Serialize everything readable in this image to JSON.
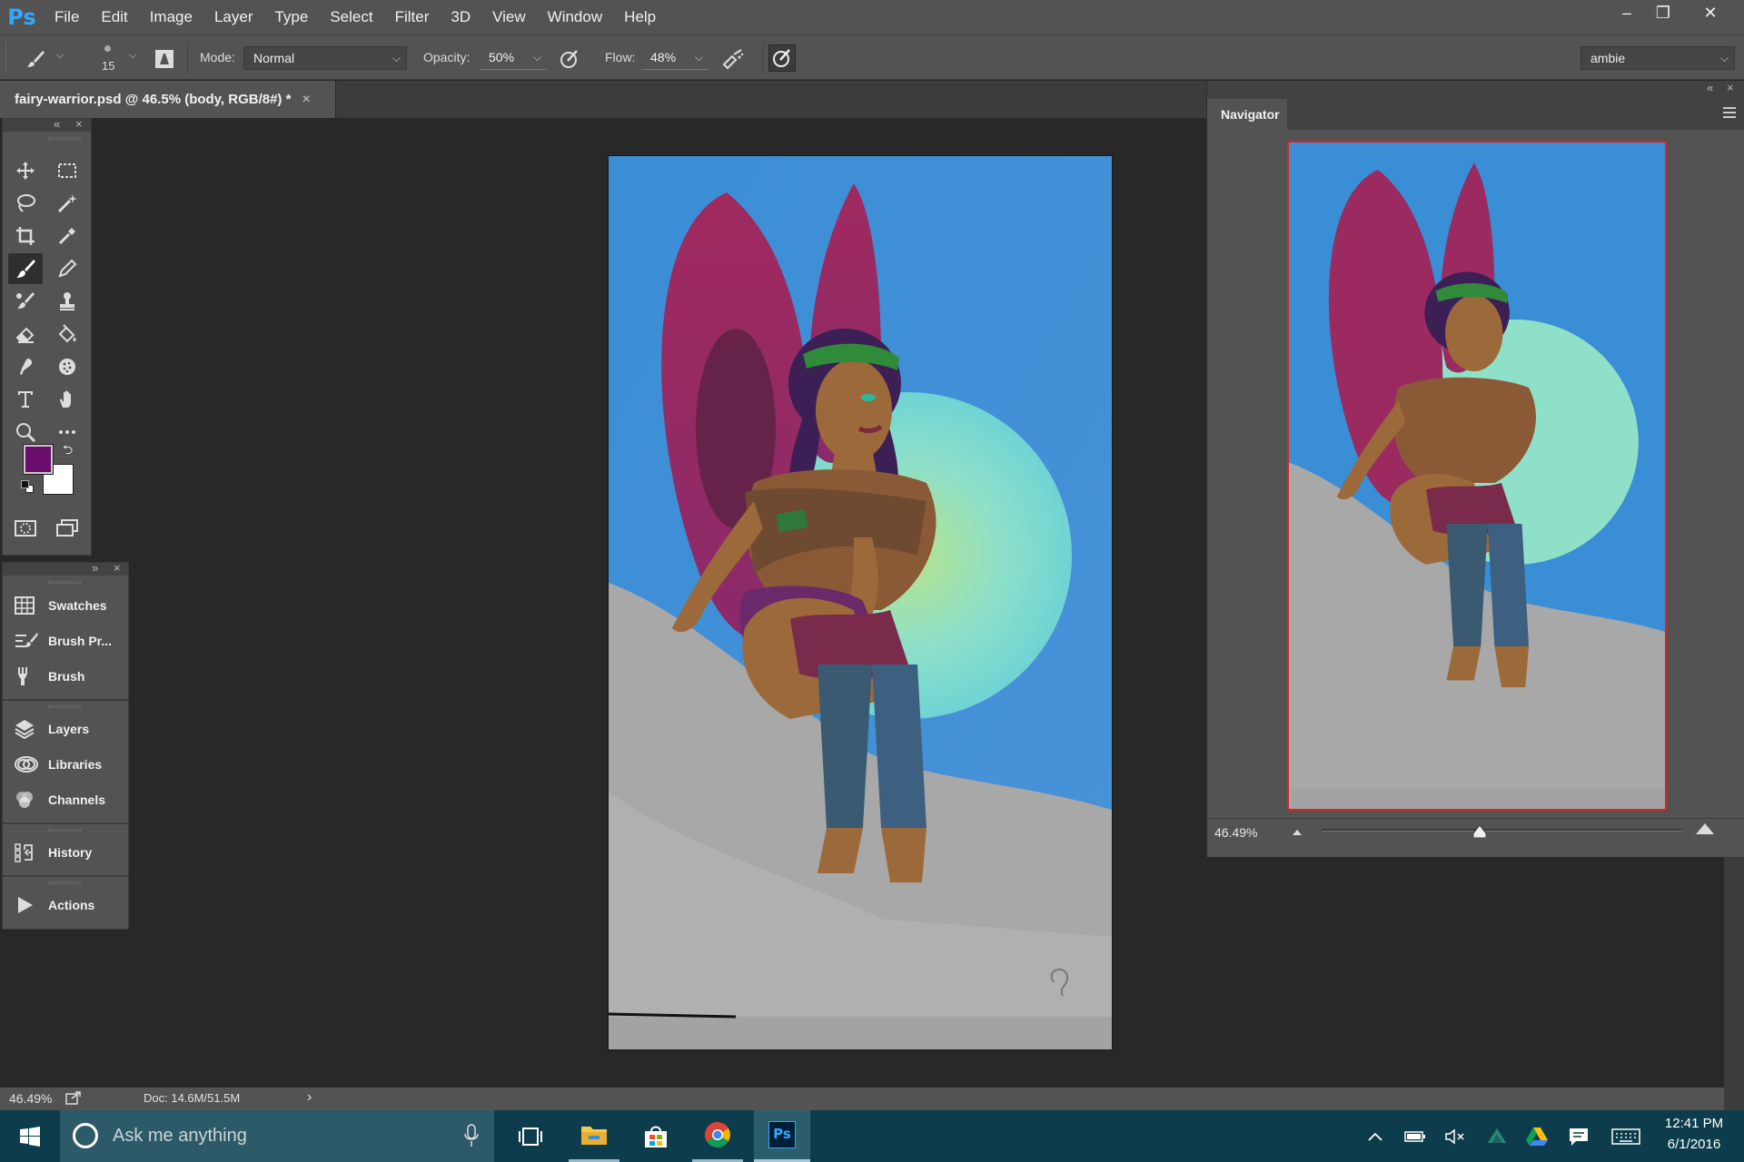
{
  "app": {
    "logo": "Ps",
    "menu": [
      "File",
      "Edit",
      "Image",
      "Layer",
      "Type",
      "Select",
      "Filter",
      "3D",
      "View",
      "Window",
      "Help"
    ],
    "window_controls": {
      "minimize": "‒",
      "restore": "❐",
      "close": "✕"
    }
  },
  "options": {
    "brush_size": "15",
    "mode_label": "Mode:",
    "mode_value": "Normal",
    "opacity_label": "Opacity:",
    "opacity_value": "50%",
    "flow_label": "Flow:",
    "flow_value": "48%",
    "workspace": "ambie"
  },
  "document": {
    "tab_title": "fairy-warrior.psd @ 46.5% (body, RGB/8#) *",
    "close": "×"
  },
  "colors": {
    "foreground": "#6b0d6b",
    "background": "#ffffff",
    "accent": "#31a8ff"
  },
  "toolbox": {
    "tools": [
      "move-tool",
      "marquee-tool",
      "lasso-tool",
      "magic-wand-tool",
      "crop-tool",
      "eyedropper-tool",
      "brush-tool",
      "pencil-tool",
      "healing-brush-tool",
      "clone-stamp-tool",
      "eraser-tool",
      "paint-bucket-tool",
      "smudge-tool",
      "sponge-tool",
      "type-tool",
      "hand-tool",
      "zoom-tool",
      "more-tools"
    ],
    "active_tool": "brush-tool"
  },
  "dock": {
    "items": [
      {
        "label": "Swatches",
        "icon": "swatches-icon"
      },
      {
        "label": "Brush Pr...",
        "icon": "brush-presets-icon"
      },
      {
        "label": "Brush",
        "icon": "brush-panel-icon"
      },
      {
        "label": "Layers",
        "icon": "layers-icon"
      },
      {
        "label": "Libraries",
        "icon": "libraries-icon"
      },
      {
        "label": "Channels",
        "icon": "channels-icon"
      },
      {
        "label": "History",
        "icon": "history-icon"
      },
      {
        "label": "Actions",
        "icon": "actions-icon"
      }
    ]
  },
  "navigator": {
    "title": "Navigator",
    "zoom": "46.49%",
    "slider_level": 0.44
  },
  "status": {
    "zoom": "46.49%",
    "doc_info": "Doc: 14.6M/51.5M",
    "arrow": "›"
  },
  "taskbar": {
    "search_placeholder": "Ask me anything",
    "time": "12:41 PM",
    "date": "6/1/2016",
    "apps": [
      "windows-start-icon",
      "cortana-icon",
      "task-view-icon",
      "file-explorer-icon",
      "store-icon",
      "chrome-icon",
      "photoshop-icon"
    ],
    "tray": [
      "chevron-up-icon",
      "battery-icon",
      "volume-mute-icon",
      "onedrive-icon",
      "google-drive-icon",
      "action-center-icon",
      "keyboard-icon"
    ]
  }
}
